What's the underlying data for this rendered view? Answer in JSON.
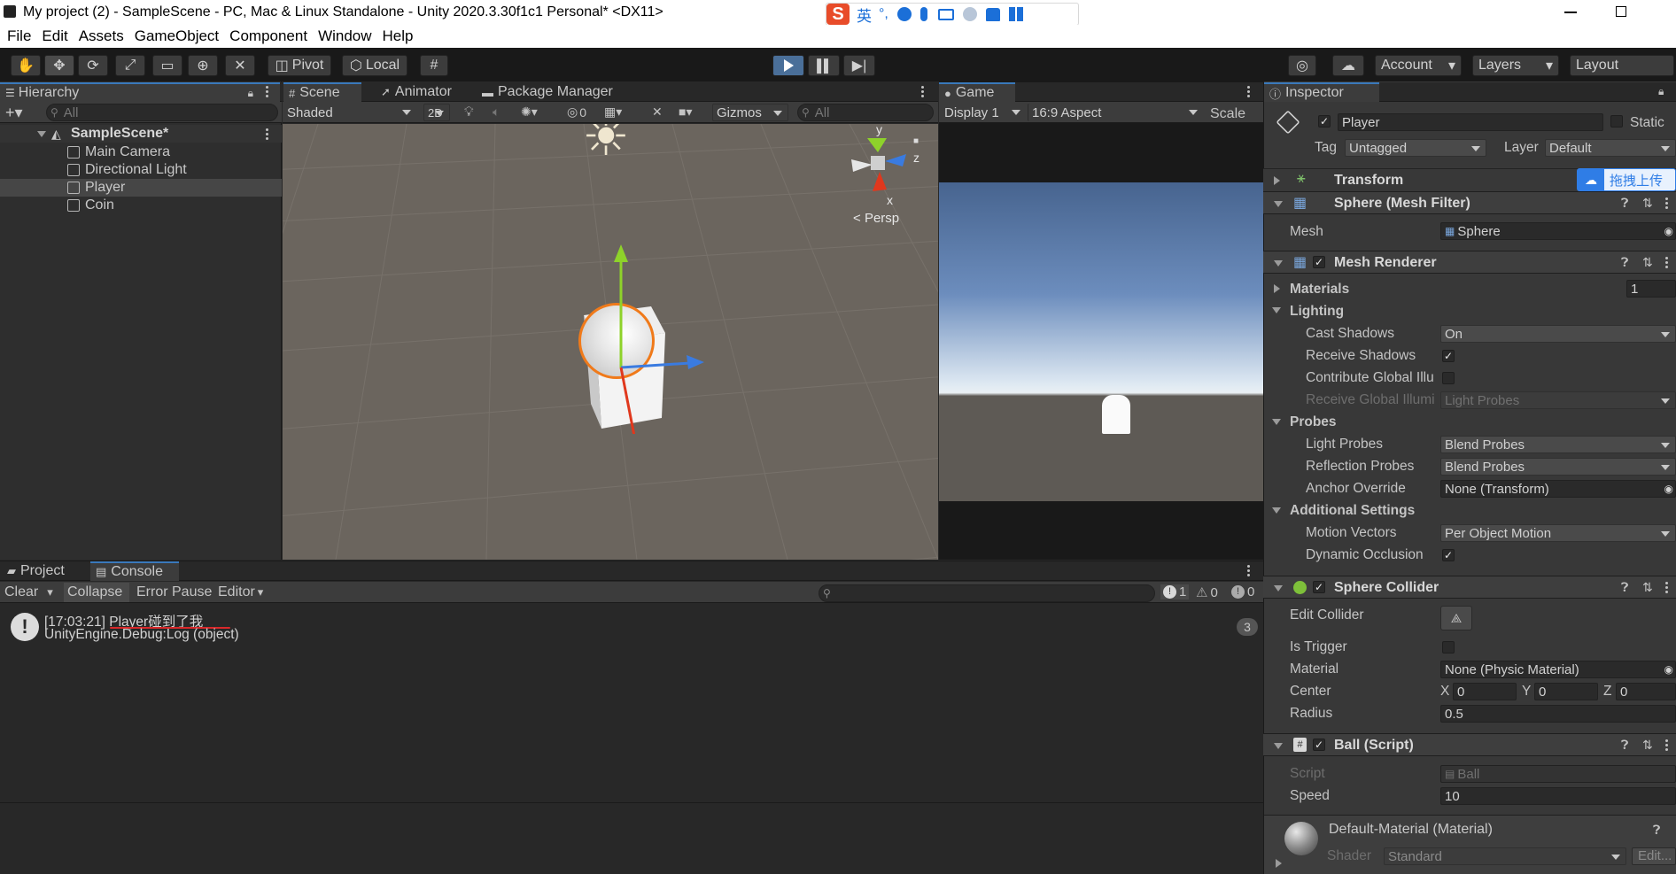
{
  "window": {
    "title": "My project (2) - SampleScene - PC, Mac & Linux Standalone - Unity 2020.3.30f1c1 Personal* <DX11>"
  },
  "ime": {
    "logo": "S",
    "mode": "英",
    "punct": "°,"
  },
  "menu": [
    "File",
    "Edit",
    "Assets",
    "GameObject",
    "Component",
    "Window",
    "Help"
  ],
  "toolbar": {
    "pivot": "Pivot",
    "local": "Local",
    "account": "Account",
    "layers": "Layers",
    "layout": "Layout"
  },
  "hierarchy": {
    "tab": "Hierarchy",
    "search_placeholder": "All",
    "scene": "SampleScene*",
    "items": [
      "Main Camera",
      "Directional Light",
      "Player",
      "Coin"
    ]
  },
  "scene": {
    "tabs": [
      "Scene",
      "Animator",
      "Package Manager"
    ],
    "shading": "Shaded",
    "mode2d": "2D",
    "hidden_count": "0",
    "gizmos": "Gizmos",
    "search_placeholder": "All",
    "persp": "Persp",
    "axis_y": "y",
    "axis_z": "z",
    "axis_x": "x"
  },
  "game": {
    "tab": "Game",
    "display": "Display 1",
    "aspect": "16:9 Aspect",
    "scale": "Scale"
  },
  "console": {
    "tabs": [
      "Project",
      "Console"
    ],
    "clear": "Clear",
    "collapse": "Collapse",
    "error_pause": "Error Pause",
    "editor": "Editor",
    "info_count": "1",
    "warn_count": "0",
    "error_count": "0",
    "log_line1": "[17:03:21] Player碰到了我",
    "log_line2": "UnityEngine.Debug:Log (object)",
    "log_count": "3"
  },
  "inspector": {
    "tab": "Inspector",
    "object_name": "Player",
    "static_label": "Static",
    "tag_label": "Tag",
    "tag_value": "Untagged",
    "layer_label": "Layer",
    "layer_value": "Default",
    "upload_tip": "拖拽上传",
    "transform": "Transform",
    "mesh_filter": "Sphere (Mesh Filter)",
    "mesh_label": "Mesh",
    "mesh_value": "Sphere",
    "mesh_renderer": "Mesh Renderer",
    "materials_label": "Materials",
    "materials_count": "1",
    "lighting_label": "Lighting",
    "cast_shadows_label": "Cast Shadows",
    "cast_shadows_value": "On",
    "receive_shadows_label": "Receive Shadows",
    "contribute_gi_label": "Contribute Global Illu",
    "receive_gi_label": "Receive Global Illumi",
    "receive_gi_value": "Light Probes",
    "probes_label": "Probes",
    "light_probes_label": "Light Probes",
    "light_probes_value": "Blend Probes",
    "reflection_probes_label": "Reflection Probes",
    "reflection_probes_value": "Blend Probes",
    "anchor_override_label": "Anchor Override",
    "anchor_override_value": "None (Transform)",
    "additional_label": "Additional Settings",
    "motion_vectors_label": "Motion Vectors",
    "motion_vectors_value": "Per Object Motion",
    "dynamic_occlusion_label": "Dynamic Occlusion",
    "sphere_collider": "Sphere Collider",
    "edit_collider_label": "Edit Collider",
    "is_trigger_label": "Is Trigger",
    "material_label": "Material",
    "material_value": "None (Physic Material)",
    "center_label": "Center",
    "center_x_label": "X",
    "center_x": "0",
    "center_y_label": "Y",
    "center_y": "0",
    "center_z_label": "Z",
    "center_z": "0",
    "radius_label": "Radius",
    "radius_value": "0.5",
    "ball_script": "Ball (Script)",
    "script_label": "Script",
    "script_value": "Ball",
    "speed_label": "Speed",
    "speed_value": "10",
    "default_material": "Default-Material (Material)",
    "shader_label": "Shader",
    "shader_value": "Standard",
    "edit_button": "Edit..."
  },
  "colors": {
    "accent": "#3a79bb",
    "play_active": "#4a6f99",
    "scene_bg": "#6b655e",
    "sky_top": "#47648f",
    "ground": "#5e5a55"
  }
}
